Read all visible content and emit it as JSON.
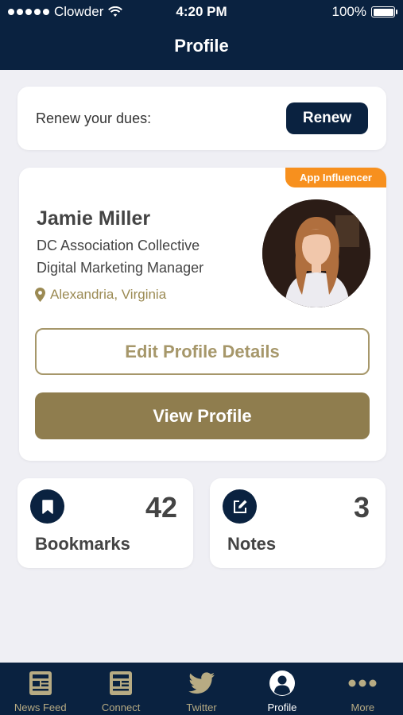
{
  "status_bar": {
    "carrier": "Clowder",
    "time": "4:20 PM",
    "battery": "100%"
  },
  "header": {
    "title": "Profile"
  },
  "dues": {
    "label": "Renew your dues:",
    "button": "Renew"
  },
  "profile": {
    "badge": "App Influencer",
    "name": "Jamie Miller",
    "organization": "DC Association Collective",
    "role": "Digital Marketing Manager",
    "location": "Alexandria, Virginia",
    "edit_button": "Edit Profile Details",
    "view_button": "View Profile"
  },
  "stats": {
    "bookmarks": {
      "count": "42",
      "label": "Bookmarks",
      "icon": "bookmark-icon"
    },
    "notes": {
      "count": "3",
      "label": "Notes",
      "icon": "note-edit-icon"
    }
  },
  "tabbar": {
    "items": [
      {
        "label": "News Feed",
        "icon": "newspaper-icon"
      },
      {
        "label": "Connect",
        "icon": "newspaper-icon"
      },
      {
        "label": "Twitter",
        "icon": "twitter-icon"
      },
      {
        "label": "Profile",
        "icon": "user-circle-icon"
      },
      {
        "label": "More",
        "icon": "more-dots-icon"
      }
    ],
    "active": "Profile"
  },
  "colors": {
    "navy": "#0a2240",
    "gold": "#8f7d4e",
    "badge_orange": "#f7901e",
    "background": "#efeff4"
  }
}
